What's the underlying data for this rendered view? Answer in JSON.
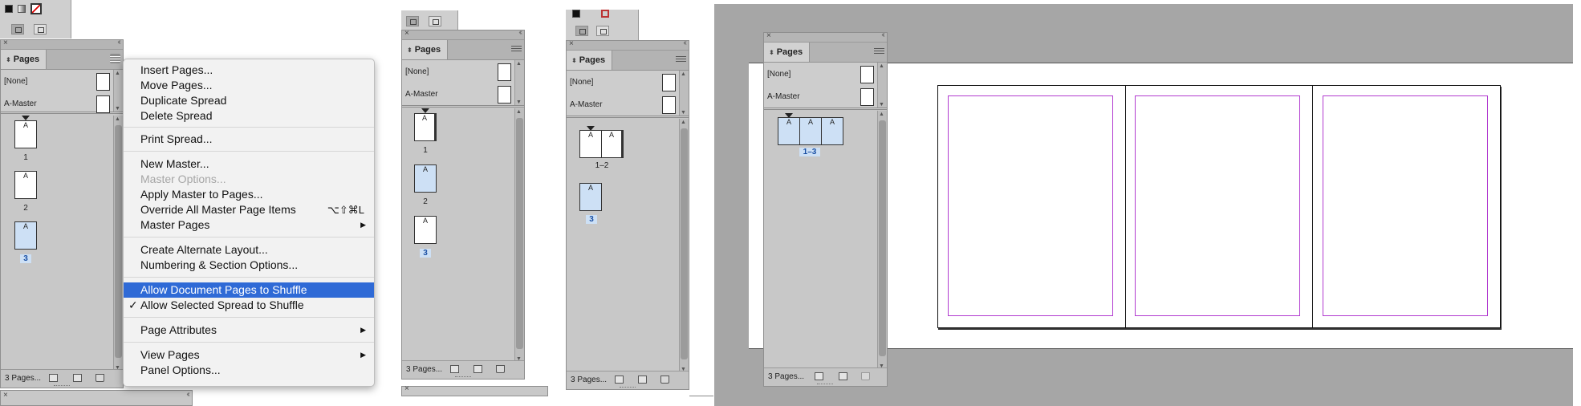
{
  "panels": [
    {
      "tab": "Pages",
      "none_label": "[None]",
      "master_label": "A-Master",
      "footer": "3 Pages...",
      "pages": [
        {
          "prefix": "A",
          "label": "1",
          "selected": false
        },
        {
          "prefix": "A",
          "label": "2",
          "selected": false
        },
        {
          "prefix": "A",
          "label": "3",
          "selected": true
        }
      ]
    },
    {
      "tab": "Pages",
      "none_label": "[None]",
      "master_label": "A-Master",
      "footer": "3 Pages...",
      "pages": [
        {
          "prefix": "A",
          "label": "1",
          "selected": false
        },
        {
          "prefix": "A",
          "label": "2",
          "selected": false
        },
        {
          "prefix": "A",
          "label": "3",
          "selected": true
        }
      ]
    },
    {
      "tab": "Pages",
      "none_label": "[None]",
      "master_label": "A-Master",
      "footer": "3 Pages...",
      "spread_label": "1–2",
      "spread_prefixes": [
        "A",
        "A"
      ],
      "single_prefix": "A",
      "single_label": "3"
    },
    {
      "tab": "Pages",
      "none_label": "[None]",
      "master_label": "A-Master",
      "footer": "3 Pages...",
      "spread_label": "1–3",
      "spread_prefixes": [
        "A",
        "A",
        "A"
      ]
    }
  ],
  "context_menu": {
    "items": [
      {
        "label": "Insert Pages...",
        "enabled": true
      },
      {
        "label": "Move Pages...",
        "enabled": true
      },
      {
        "label": "Duplicate Spread",
        "enabled": true
      },
      {
        "label": "Delete Spread",
        "enabled": true
      },
      {
        "label": "Print Spread...",
        "enabled": true
      },
      {
        "label": "New Master...",
        "enabled": true
      },
      {
        "label": "Master Options...",
        "enabled": false
      },
      {
        "label": "Apply Master to Pages...",
        "enabled": true
      },
      {
        "label": "Override All Master Page Items",
        "shortcut": "⌥⇧⌘L",
        "enabled": true
      },
      {
        "label": "Master Pages",
        "submenu": true,
        "enabled": true
      },
      {
        "label": "Create Alternate Layout...",
        "enabled": true
      },
      {
        "label": "Numbering & Section Options...",
        "enabled": true
      },
      {
        "label": "Allow Document Pages to Shuffle",
        "highlighted": true,
        "enabled": true
      },
      {
        "label": "Allow Selected Spread to Shuffle",
        "checked": true,
        "check_mark": "✓",
        "enabled": true
      },
      {
        "label": "Page Attributes",
        "submenu": true,
        "enabled": true
      },
      {
        "label": "View Pages",
        "submenu": true,
        "enabled": true
      },
      {
        "label": "Panel Options...",
        "enabled": true
      }
    ]
  },
  "colors": {
    "highlight": "#2f6ad6",
    "selected_page": "#cde0f5",
    "margin_guide": "#b23bd0",
    "pasteboard": "#a6a6a6"
  }
}
